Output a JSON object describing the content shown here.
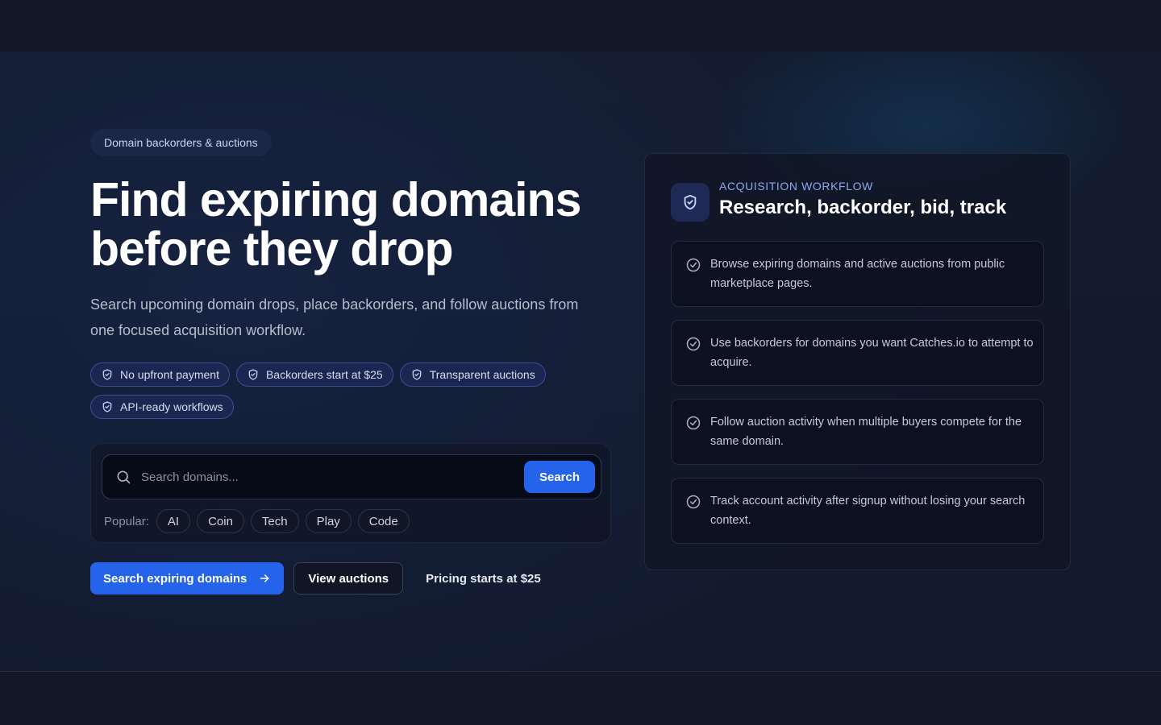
{
  "hero": {
    "eyebrow": "Domain backorders & auctions",
    "headline_line1": "Find expiring domains",
    "headline_line2": "before they drop",
    "subtitle": "Search upcoming domain drops, place backorders, and follow auctions from one focused acquisition workflow.",
    "features": [
      {
        "label": "No upfront payment",
        "icon": "shield-check-icon"
      },
      {
        "label": "Backorders start at $25",
        "icon": "shield-check-icon"
      },
      {
        "label": "Transparent auctions",
        "icon": "shield-check-icon"
      },
      {
        "label": "API-ready workflows",
        "icon": "shield-check-icon"
      }
    ]
  },
  "search": {
    "placeholder": "Search domains...",
    "button_label": "Search",
    "popular_label": "Popular:",
    "popular_chips": [
      "AI",
      "Coin",
      "Tech",
      "Play",
      "Code"
    ]
  },
  "cta": {
    "primary_label": "Search expiring domains",
    "secondary_label": "View auctions",
    "pricing_text": "Pricing starts at $25"
  },
  "workflow": {
    "eyebrow": "ACQUISITION WORKFLOW",
    "title": "Research, backorder, bid, track",
    "steps": [
      "Browse expiring domains and active auctions from public marketplace pages.",
      "Use backorders for domains you want Catches.io to attempt to acquire.",
      "Follow auction activity when multiple buyers compete for the same domain.",
      "Track account activity after signup without losing your search context."
    ]
  },
  "colors": {
    "background": "#121826",
    "accent": "#2563eb",
    "feature_border": "#3a4f96",
    "eyebrow_text": "#8fa6ee"
  }
}
